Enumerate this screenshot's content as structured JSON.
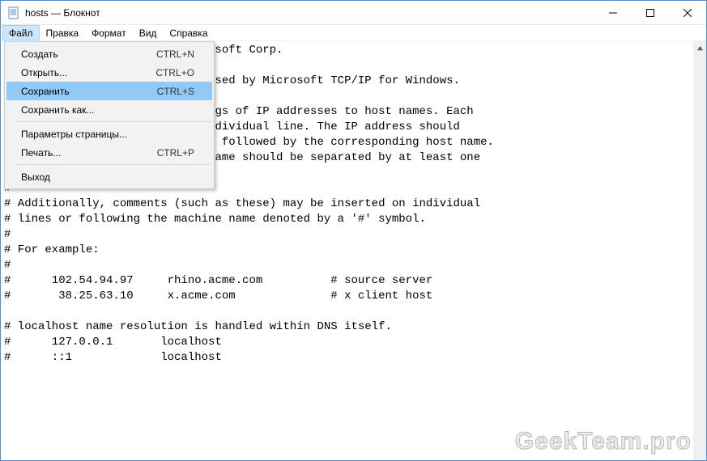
{
  "window": {
    "title": "hosts — Блокнот"
  },
  "menubar": {
    "file": "Файл",
    "edit": "Правка",
    "format": "Формат",
    "view": "Вид",
    "help": "Справка"
  },
  "file_menu": {
    "new": {
      "label": "Создать",
      "shortcut": "CTRL+N"
    },
    "open": {
      "label": "Открыть...",
      "shortcut": "CTRL+O"
    },
    "save": {
      "label": "Сохранить",
      "shortcut": "CTRL+S"
    },
    "save_as": {
      "label": "Сохранить как...",
      "shortcut": ""
    },
    "page_setup": {
      "label": "Параметры страницы...",
      "shortcut": ""
    },
    "print": {
      "label": "Печать...",
      "shortcut": "CTRL+P"
    },
    "exit": {
      "label": "Выход",
      "shortcut": ""
    }
  },
  "editor": {
    "text": "# Copyright (c) 1993-2009 Microsoft Corp.\n#\n# This is a sample HOSTS file used by Microsoft TCP/IP for Windows.\n#\n# This file contains the mappings of IP addresses to host names. Each\n# entry should be kept on an individual line. The IP address should\n# be placed in the first column followed by the corresponding host name.\n# The IP address and the host name should be separated by at least one\n# space.\n#\n# Additionally, comments (such as these) may be inserted on individual\n# lines or following the machine name denoted by a '#' symbol.\n#\n# For example:\n#\n#      102.54.94.97     rhino.acme.com          # source server\n#       38.25.63.10     x.acme.com              # x client host\n\n# localhost name resolution is handled within DNS itself.\n#      127.0.0.1       localhost\n#      ::1             localhost"
  },
  "watermark": "GeekTeam.pro"
}
